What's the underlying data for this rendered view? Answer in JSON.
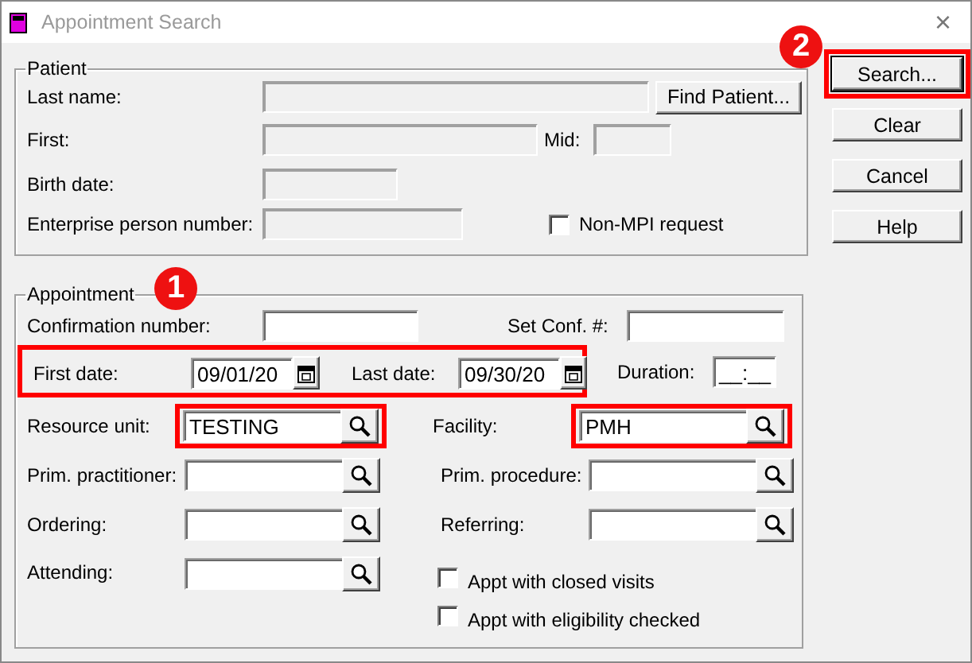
{
  "window": {
    "title": "Appointment Search",
    "close": "×"
  },
  "patient": {
    "legend": "Patient",
    "last_name": {
      "label": "Last name:",
      "disabled": true
    },
    "find_button": {
      "label": "Find Patient..."
    },
    "first": {
      "label": "First:",
      "disabled": true
    },
    "mid": {
      "label": "Mid:",
      "disabled": true
    },
    "birth_date": {
      "label": "Birth date:",
      "disabled": true
    },
    "enterprise_person_number": {
      "label": "Enterprise person number:",
      "disabled": true
    },
    "non_mpi": {
      "label": "Non-MPI request",
      "checked": false
    }
  },
  "appointment": {
    "legend": "Appointment",
    "callout": "1",
    "confirmation_number": {
      "label": "Confirmation number:",
      "disabled": false
    },
    "set_conf": {
      "label": "Set Conf. #:",
      "disabled": false
    },
    "dates": {
      "highlighted": true,
      "first_date": {
        "label": "First date:",
        "value": "09/01/20"
      },
      "last_date": {
        "label": "Last date:",
        "value": "09/30/20"
      }
    },
    "duration": {
      "label": "Duration:",
      "value": "__:__"
    },
    "lookups": [
      {
        "label": "Resource unit:",
        "value": "TESTING",
        "highlighted": true
      },
      {
        "label": "Facility:",
        "value": "PMH",
        "highlighted": true
      },
      {
        "label": "Prim. practitioner:",
        "highlighted": false
      },
      {
        "label": "Prim. procedure:",
        "highlighted": false
      },
      {
        "label": "Ordering:",
        "highlighted": false
      },
      {
        "label": "Referring:",
        "highlighted": false
      },
      {
        "label": "Attending:",
        "highlighted": false
      }
    ],
    "checkboxes": [
      {
        "label": "Appt with closed visits",
        "checked": false
      },
      {
        "label": "Appt with eligibility checked",
        "checked": false
      }
    ]
  },
  "buttons": {
    "callout": "2",
    "items": [
      {
        "label": "Search...",
        "highlighted": true
      },
      {
        "label": "Clear",
        "highlighted": false
      },
      {
        "label": "Cancel",
        "highlighted": false
      },
      {
        "label": "Help",
        "highlighted": false
      }
    ]
  }
}
